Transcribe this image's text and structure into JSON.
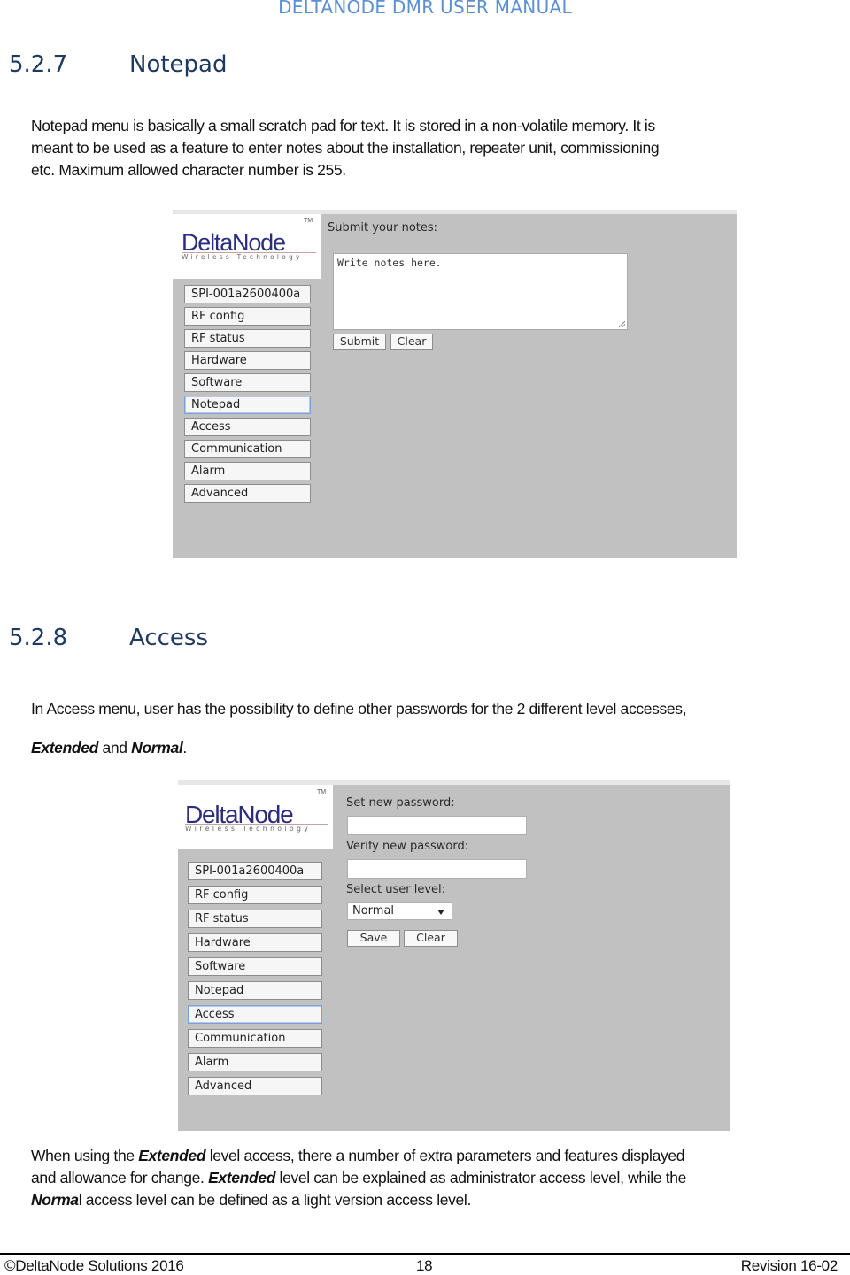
{
  "header": {
    "title": "DELTANODE DMR USER MANUAL"
  },
  "sections": [
    {
      "number": "5.2.7",
      "title": "Notepad",
      "paragraph_lines": [
        "Notepad menu is basically a small scratch pad for text. It is stored in a non-volatile memory. It is",
        "meant to be used as a feature to enter notes about the installation, repeater unit, commissioning",
        "etc. Maximum allowed character number is 255."
      ]
    },
    {
      "number": "5.2.8",
      "title": "Access",
      "intro_line1": "In Access menu, user has the possibility to define other passwords for the 2 different level accesses,",
      "intro_line2_bold1": "Extended",
      "intro_line2_mid": " and ",
      "intro_line2_bold2": "Normal",
      "intro_line2_end": ".",
      "after": {
        "l1_pre": "When using the ",
        "l1_bold": "Extended",
        "l1_post": " level access, there a number of extra parameters and features displayed",
        "l2_pre": "and allowance for change. ",
        "l2_bold": "Extended",
        "l2_post": " level can be explained as administrator access level, while the",
        "l3_bold": "Norma",
        "l3_post": "l access level can be defined as a light version access level."
      }
    }
  ],
  "logo": {
    "name": "DeltaNode",
    "tm": "TM",
    "tagline": "Wireless   Technology"
  },
  "menu_items": [
    "SPI-001a2600400a",
    "RF config",
    "RF status",
    "Hardware",
    "Software",
    "Notepad",
    "Access",
    "Communication",
    "Alarm",
    "Advanced"
  ],
  "notepad_screen": {
    "active_item": "Notepad",
    "label": "Submit your notes:",
    "textarea_value": "Write notes here.",
    "submit_label": "Submit",
    "clear_label": "Clear"
  },
  "access_screen": {
    "active_item": "Access",
    "new_password_label": "Set new password:",
    "new_password_value": "",
    "verify_password_label": "Verify new password:",
    "verify_password_value": "",
    "user_level_label": "Select user level:",
    "user_level_selected": "Normal",
    "save_label": "Save",
    "clear_label": "Clear"
  },
  "footer": {
    "copyright": "©DeltaNode Solutions 2016",
    "page_number": "18",
    "revision": "Revision 16-02"
  }
}
